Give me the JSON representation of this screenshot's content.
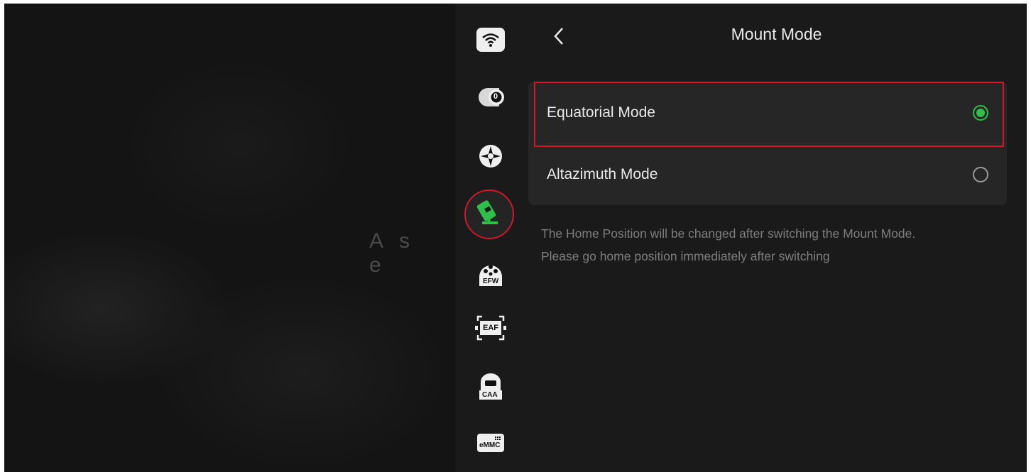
{
  "preview": {
    "overlay_text": "As e"
  },
  "sidebar": {
    "items": [
      {
        "name": "wifi",
        "icon": "wifi-icon",
        "label": ""
      },
      {
        "name": "camera",
        "icon": "camera-icon",
        "label": "0"
      },
      {
        "name": "guide",
        "icon": "crosshair-icon",
        "label": ""
      },
      {
        "name": "mount",
        "icon": "telescope-mount-icon",
        "label": "",
        "active": true
      },
      {
        "name": "efw",
        "icon": "filter-wheel-icon",
        "label": "EFW"
      },
      {
        "name": "eaf",
        "icon": "focuser-icon",
        "label": "EAF"
      },
      {
        "name": "caa",
        "icon": "rotator-icon",
        "label": "CAA"
      },
      {
        "name": "emmc",
        "icon": "storage-icon",
        "label": "eMMC"
      }
    ]
  },
  "header": {
    "back_icon": "chevron-left-icon",
    "title": "Mount Mode"
  },
  "options": [
    {
      "label": "Equatorial Mode",
      "selected": true
    },
    {
      "label": "Altazimuth Mode",
      "selected": false
    }
  ],
  "note": {
    "line1": "The Home Position will be changed after switching the Mount Mode.",
    "line2": "Please go home position immediately after switching"
  },
  "colors": {
    "accent_green": "#2ec04a",
    "highlight_red": "#d0182a",
    "background": "#1a1a1b"
  }
}
